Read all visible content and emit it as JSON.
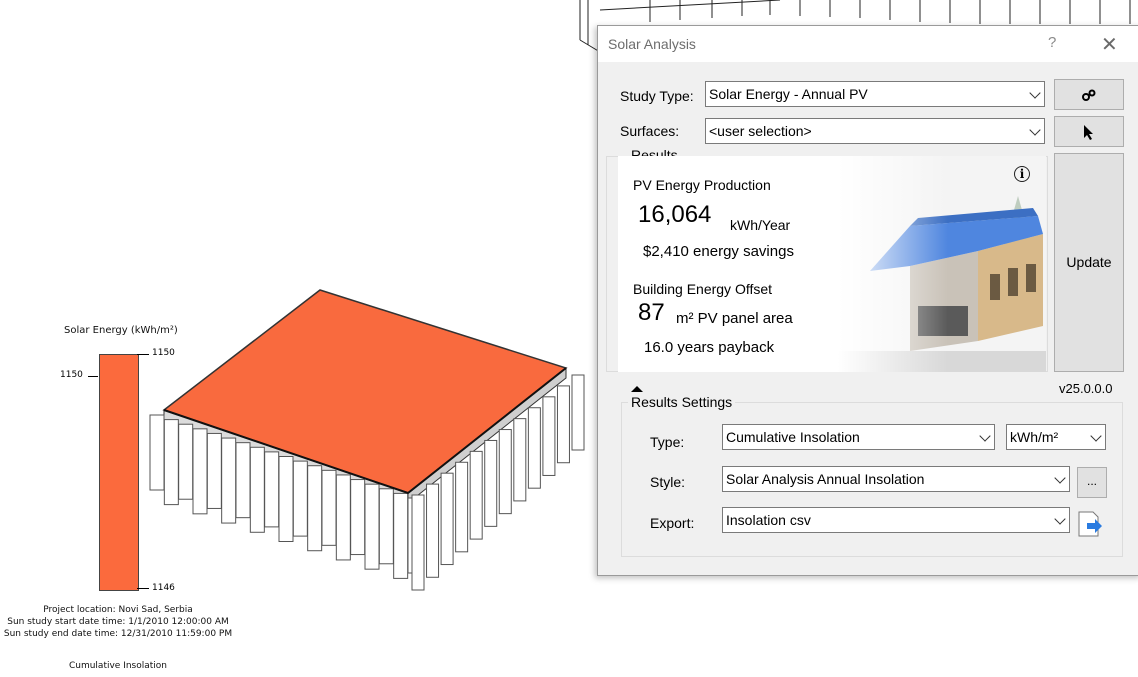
{
  "canvas": {
    "legend": {
      "title": "Solar Energy (kWh/m²)",
      "max_label": "1150",
      "min_label": "1146",
      "side_label": "1150",
      "color": "#fb6a3d"
    },
    "info": {
      "location": "Project location: Novi Sad, Serbia",
      "start": "Sun study start date time: 1/1/2010 12:00:00 AM",
      "end": "Sun study end date time: 12/31/2010 11:59:00 PM"
    },
    "caption": "Cumulative Insolation",
    "roof_color": "#f96a3e"
  },
  "dialog": {
    "title": "Solar Analysis",
    "help": "?",
    "close": "✕",
    "study_type": {
      "label": "Study Type:",
      "value": "Solar Energy - Annual PV"
    },
    "surfaces": {
      "label": "Surfaces:",
      "value": "<user selection>"
    },
    "update_label": "Update",
    "results": {
      "group_label": "Results",
      "pv_heading": "PV Energy Production",
      "pv_value": "16,064",
      "pv_unit": "kWh/Year",
      "savings": "$2,410 energy savings",
      "offset_heading": "Building Energy Offset",
      "area_value": "87",
      "area_unit": "m² PV panel area",
      "payback": "16.0 years payback",
      "info": "i"
    },
    "version": "v25.0.0.0",
    "settings": {
      "group_label": "Results Settings",
      "type": {
        "label": "Type:",
        "value": "Cumulative Insolation",
        "unit": "kWh/m²"
      },
      "style": {
        "label": "Style:",
        "value": "Solar Analysis Annual Insolation",
        "button": "..."
      },
      "export": {
        "label": "Export:",
        "value": "Insolation csv"
      }
    }
  }
}
